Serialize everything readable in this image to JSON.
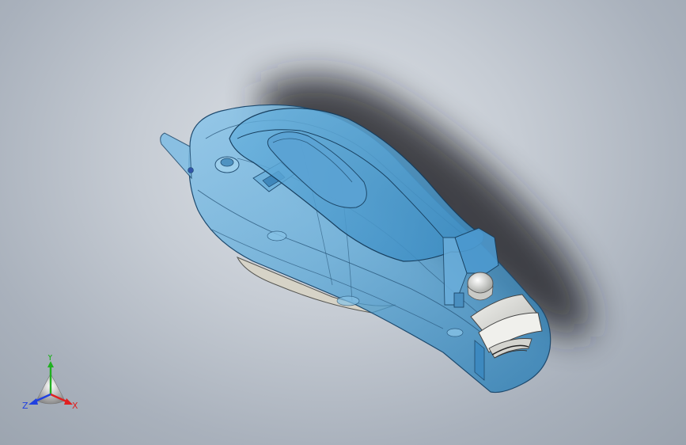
{
  "window": {
    "type": "3d-cad-viewport",
    "background_colors": [
      "#dfe3e8",
      "#c6ccd4",
      "#9aa3ae"
    ]
  },
  "model": {
    "render_style": "transparent-blue",
    "primary_color": "#5aa8d8",
    "edge_color": "#1e4a6e",
    "clip_color": "#e8e8e4"
  },
  "triad": {
    "x_label": "X",
    "y_label": "Y",
    "z_label": "Z",
    "x_color": "#e02020",
    "y_color": "#20b020",
    "z_color": "#2040e0"
  }
}
